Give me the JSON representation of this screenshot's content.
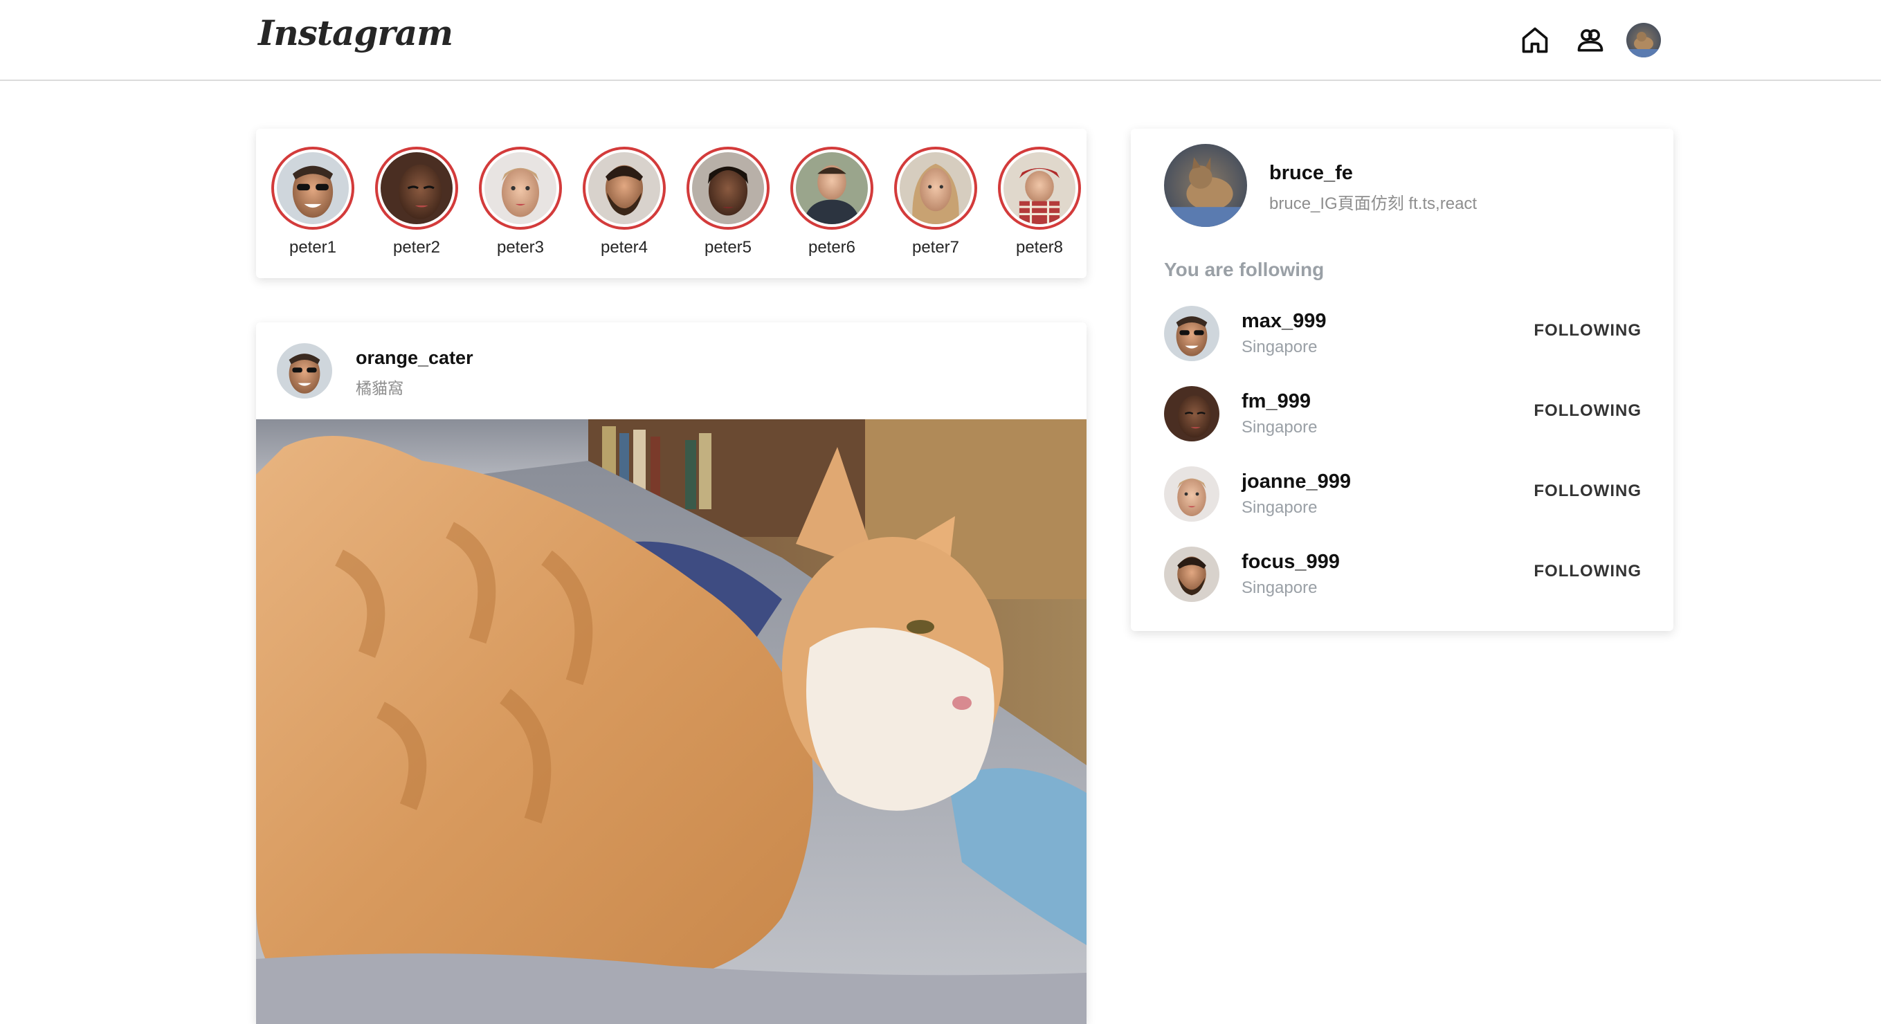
{
  "header": {
    "logo": "Instagram",
    "icons": [
      "home-icon",
      "people-icon",
      "profile-avatar"
    ]
  },
  "stories": [
    {
      "name": "peter1"
    },
    {
      "name": "peter2"
    },
    {
      "name": "peter3"
    },
    {
      "name": "peter4"
    },
    {
      "name": "peter5"
    },
    {
      "name": "peter6"
    },
    {
      "name": "peter7"
    },
    {
      "name": "peter8"
    }
  ],
  "post": {
    "username": "orange_cater",
    "subtitle": "橘貓窩"
  },
  "sidebar": {
    "profile": {
      "username": "bruce_fe",
      "bio": "bruce_IG頁面仿刻 ft.ts,react"
    },
    "following_title": "You are following",
    "following": [
      {
        "name": "max_999",
        "location": "Singapore",
        "button": "FOLLOWING"
      },
      {
        "name": "fm_999",
        "location": "Singapore",
        "button": "FOLLOWING"
      },
      {
        "name": "joanne_999",
        "location": "Singapore",
        "button": "FOLLOWING"
      },
      {
        "name": "focus_999",
        "location": "Singapore",
        "button": "FOLLOWING"
      }
    ]
  },
  "colors": {
    "story_ring": "#d33b3b",
    "border": "#dbdbdb",
    "muted": "#8e8e8e"
  }
}
